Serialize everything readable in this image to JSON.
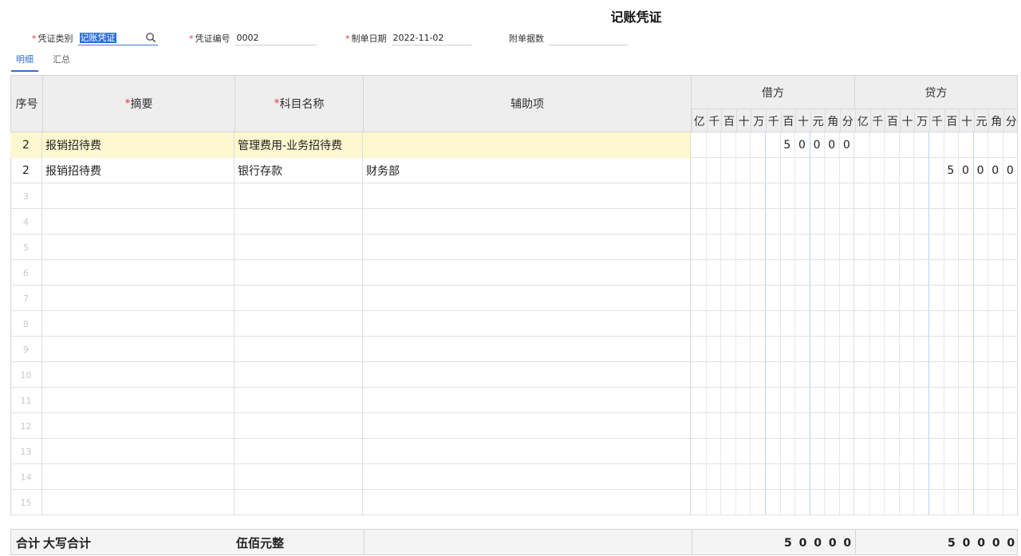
{
  "title": "记账凭证",
  "header": {
    "voucher_type": {
      "label": "凭证类别",
      "value": "记账凭证"
    },
    "voucher_no": {
      "label": "凭证编号",
      "value": "0002"
    },
    "date": {
      "label": "制单日期",
      "value": "2022-11-02"
    },
    "attachments": {
      "label": "附单据数",
      "value": ""
    }
  },
  "tabs": [
    {
      "label": "明细",
      "active": true
    },
    {
      "label": "汇总",
      "active": false
    }
  ],
  "columns": {
    "index": "序号",
    "summary": "摘要",
    "account": "科目名称",
    "aux": "辅助项",
    "debit": "借方",
    "credit": "贷方"
  },
  "digit_units": [
    "亿",
    "千",
    "百",
    "十",
    "万",
    "千",
    "百",
    "十",
    "元",
    "角",
    "分"
  ],
  "rows": [
    {
      "index": "2",
      "summary": "报销招待费",
      "account": "管理费用-业务招待费",
      "aux": "",
      "debit": "50000",
      "credit": ""
    },
    {
      "index": "2",
      "summary": "报销招待费",
      "account": "银行存款",
      "aux": "财务部",
      "debit": "",
      "credit": "50000"
    },
    {
      "index": "3"
    },
    {
      "index": "4"
    },
    {
      "index": "5"
    },
    {
      "index": "6"
    },
    {
      "index": "7"
    },
    {
      "index": "8"
    },
    {
      "index": "9"
    },
    {
      "index": "10"
    },
    {
      "index": "11"
    },
    {
      "index": "12"
    },
    {
      "index": "13"
    },
    {
      "index": "14"
    },
    {
      "index": "15"
    }
  ],
  "total": {
    "label": "合计",
    "upper_label": "大写合计",
    "upper_value": "伍佰元整",
    "debit": "50000",
    "credit": "50000"
  },
  "colors": {
    "accent": "#2f6fd6",
    "required": "#e53935",
    "highlight": "#fff7cf"
  }
}
